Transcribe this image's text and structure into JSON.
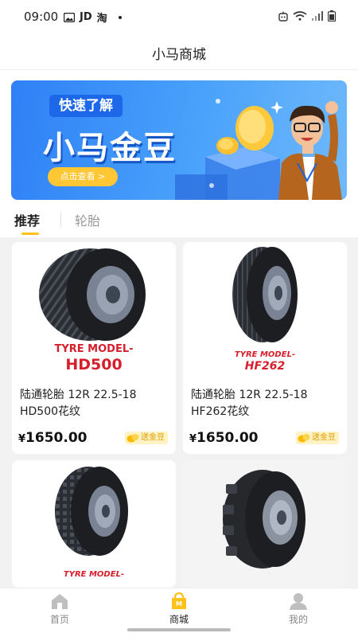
{
  "status_bar": {
    "time": "09:00",
    "left_icons": [
      "image-icon",
      "jd-icon",
      "taobao-icon",
      "dot-icon"
    ],
    "jd_text": "JD",
    "taobao_text": "淘",
    "right_icons": [
      "robot-icon",
      "wifi-icon",
      "signal-icon",
      "battery-icon"
    ]
  },
  "header": {
    "title": "小马商城"
  },
  "banner": {
    "tag": "快速了解",
    "title": "小马金豆",
    "button": "点击查看 >"
  },
  "tabs": [
    {
      "label": "推荐",
      "active": true
    },
    {
      "label": "轮胎",
      "active": false
    }
  ],
  "products": [
    {
      "model_label": "TYRE MODEL-",
      "model_code": "HD500",
      "name": "  陆通轮胎 12R 22.5-18 HD500花纹",
      "price_symbol": "¥",
      "price": "1650.00",
      "badge": "送金豆"
    },
    {
      "model_label": "TYRE MODEL-",
      "model_code": "HF262",
      "name": "  陆通轮胎 12R 22.5-18 HF262花纹",
      "price_symbol": "¥",
      "price": "1650.00",
      "badge": "送金豆"
    },
    {
      "model_label": "TYRE MODEL-",
      "model_code": ""
    },
    {
      "model_label": "",
      "model_code": ""
    }
  ],
  "bottom_nav": [
    {
      "label": "首页",
      "icon": "home-icon",
      "active": false
    },
    {
      "label": "商城",
      "icon": "mall-icon",
      "active": true
    },
    {
      "label": "我的",
      "icon": "profile-icon",
      "active": false
    }
  ],
  "colors": {
    "accent": "#ffc21a",
    "banner_blue": "#2f80f6",
    "model_red": "#d61f2c",
    "badge_text": "#e09a00"
  }
}
